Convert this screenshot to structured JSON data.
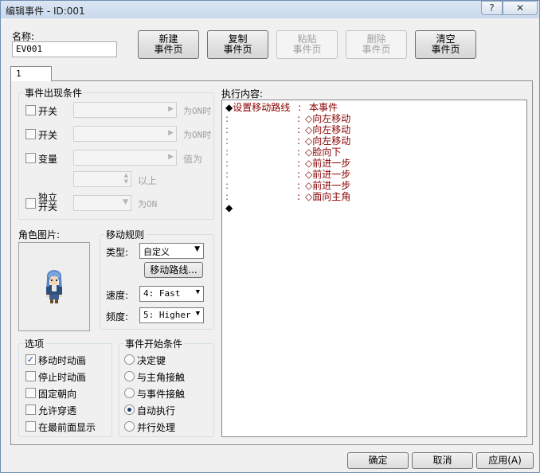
{
  "window": {
    "title": "编辑事件 - ID:001",
    "help": "?",
    "close": "✕"
  },
  "name": {
    "label": "名称:",
    "value": "EV001"
  },
  "page_buttons": {
    "new": [
      "新建",
      "事件页"
    ],
    "copy": [
      "复制",
      "事件页"
    ],
    "paste": [
      "粘贴",
      "事件页"
    ],
    "delete": [
      "删除",
      "事件页"
    ],
    "clear": [
      "清空",
      "事件页"
    ]
  },
  "tab": "1",
  "conditions": {
    "title": "事件出现条件",
    "switch1": "开关",
    "switch1_suffix": "为ON时",
    "switch2": "开关",
    "switch2_suffix": "为ON时",
    "variable": "变量",
    "variable_suffix": "值为",
    "above": "以上",
    "self_switch": [
      "独立",
      "开关"
    ],
    "self_switch_suffix": "为ON"
  },
  "graphic": {
    "title": "角色图片:"
  },
  "movement": {
    "title": "移动规则",
    "type_label": "类型:",
    "type_value": "自定义",
    "route_button": "移动路线...",
    "speed_label": "速度:",
    "speed_value": "4: Fast",
    "freq_label": "频度:",
    "freq_value": "5: Higher"
  },
  "options": {
    "title": "选项",
    "items": [
      {
        "label": "移动时动画",
        "checked": true
      },
      {
        "label": "停止时动画",
        "checked": false
      },
      {
        "label": "固定朝向",
        "checked": false
      },
      {
        "label": "允许穿透",
        "checked": false
      },
      {
        "label": "在最前面显示",
        "checked": false
      }
    ]
  },
  "trigger": {
    "title": "事件开始条件",
    "items": [
      {
        "label": "决定键",
        "selected": false
      },
      {
        "label": "与主角接触",
        "selected": false
      },
      {
        "label": "与事件接触",
        "selected": false
      },
      {
        "label": "自动执行",
        "selected": true
      },
      {
        "label": "并行处理",
        "selected": false
      }
    ]
  },
  "contents": {
    "title": "执行内容:",
    "first": {
      "bullet": "◆",
      "cmd": "设置移动路线",
      "sep": ":",
      "target": "本事件"
    },
    "steps": [
      "◇向左移动",
      "◇向左移动",
      "◇向左移动",
      "◇脸向下",
      "◇前进一步",
      "◇前进一步",
      "◇前进一步",
      "◇面向主角"
    ],
    "step_prefix": ":",
    "step_sep": ":",
    "end": "◆"
  },
  "footer": {
    "ok": "确定",
    "cancel": "取消",
    "apply": "应用(A)"
  }
}
